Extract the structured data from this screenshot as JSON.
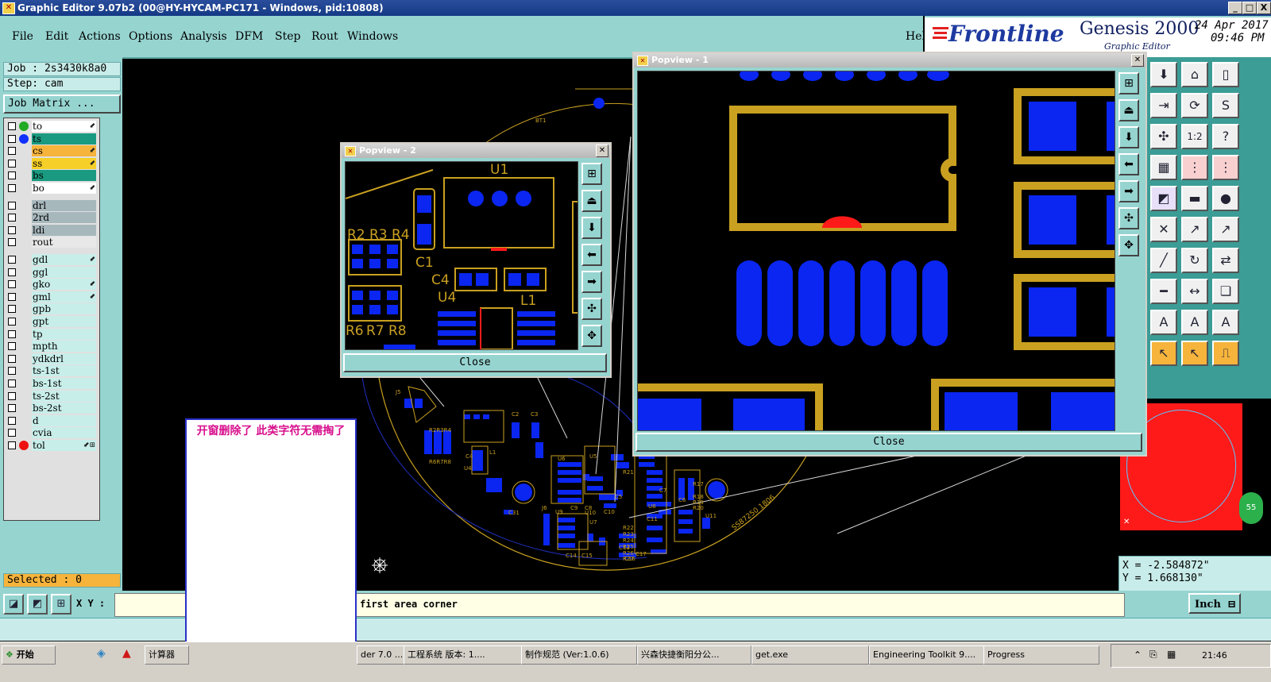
{
  "window": {
    "title": "Graphic Editor 9.07b2 (00@HY-HYCAM-PC171 - Windows, pid:10808)",
    "buttons": [
      "_",
      "□",
      "X"
    ]
  },
  "menu": {
    "items": [
      "File",
      "Edit",
      "Actions",
      "Options",
      "Analysis",
      "DFM",
      "Step",
      "Rout",
      "Windows"
    ],
    "help": "Help"
  },
  "brand": {
    "logo": "Frontline",
    "product": "Genesis 2000",
    "subtitle": "Graphic Editor",
    "date": "24 Apr 2017",
    "time": "09:46 PM"
  },
  "job": {
    "job_label": "Job : 2s3430k8a0",
    "step_label": "Step: cam",
    "matrix_button": "Job Matrix ..."
  },
  "layers": [
    {
      "name": "to",
      "dot": "#22aa22",
      "bg": "#ffffff",
      "mark": "⬋"
    },
    {
      "name": "ts",
      "dot": "#1030ff",
      "bg": "#1a9a80",
      "mark": ""
    },
    {
      "name": "cs",
      "dot": "",
      "bg": "#f6b43c",
      "mark": "⬋"
    },
    {
      "name": "ss",
      "dot": "",
      "bg": "#f6d028",
      "mark": "⬋"
    },
    {
      "name": "bs",
      "dot": "",
      "bg": "#1a9a80",
      "mark": ""
    },
    {
      "name": "bo",
      "dot": "",
      "bg": "#ffffff",
      "mark": "⬋"
    },
    {
      "name": "drl",
      "dot": "",
      "bg": "#a7b8bd",
      "mark": ""
    },
    {
      "name": "2rd",
      "dot": "",
      "bg": "#a7b8bd",
      "mark": ""
    },
    {
      "name": "ldi",
      "dot": "",
      "bg": "#a7b8bd",
      "mark": ""
    },
    {
      "name": "rout",
      "dot": "",
      "bg": "#e8e8e8",
      "mark": ""
    },
    {
      "name": "gdl",
      "dot": "",
      "bg": "#c8eeea",
      "mark": "⬋"
    },
    {
      "name": "ggl",
      "dot": "",
      "bg": "#c8eeea",
      "mark": ""
    },
    {
      "name": "gko",
      "dot": "",
      "bg": "#c8eeea",
      "mark": "⬋"
    },
    {
      "name": "gml",
      "dot": "",
      "bg": "#c8eeea",
      "mark": "⬋"
    },
    {
      "name": "gpb",
      "dot": "",
      "bg": "#c8eeea",
      "mark": ""
    },
    {
      "name": "gpt",
      "dot": "",
      "bg": "#c8eeea",
      "mark": ""
    },
    {
      "name": "tp",
      "dot": "",
      "bg": "#c8eeea",
      "mark": ""
    },
    {
      "name": "mpth",
      "dot": "",
      "bg": "#c8eeea",
      "mark": ""
    },
    {
      "name": "ydkdrl",
      "dot": "",
      "bg": "#c8eeea",
      "mark": ""
    },
    {
      "name": "ts-1st",
      "dot": "",
      "bg": "#c8eeea",
      "mark": ""
    },
    {
      "name": "bs-1st",
      "dot": "",
      "bg": "#c8eeea",
      "mark": ""
    },
    {
      "name": "ts-2st",
      "dot": "",
      "bg": "#c8eeea",
      "mark": ""
    },
    {
      "name": "bs-2st",
      "dot": "",
      "bg": "#c8eeea",
      "mark": ""
    },
    {
      "name": "d",
      "dot": "",
      "bg": "#c8eeea",
      "mark": ""
    },
    {
      "name": "cvia",
      "dot": "",
      "bg": "#c8eeea",
      "mark": ""
    },
    {
      "name": "tol",
      "dot": "#ee1111",
      "bg": "#c8eeea",
      "mark": "⬋⊞"
    }
  ],
  "selected": "Selected : 0",
  "popview2": {
    "title": "Popview - 2",
    "close": "Close",
    "labels": [
      "U1",
      "R2",
      "R3",
      "R4",
      "C1",
      "C4",
      "U4",
      "L1",
      "R6",
      "R7",
      "R8"
    ]
  },
  "popview1": {
    "title": "Popview - 1",
    "close": "Close"
  },
  "note": {
    "text": "开窗删除了   此类字符无需掏了"
  },
  "pcb_labels": [
    "BT1",
    "J5",
    "U6",
    "U5",
    "C9",
    "C8",
    "C5",
    "C10",
    "U7",
    "J6",
    "U9",
    "U10",
    "U8",
    "C6",
    "C7",
    "C11",
    "C13",
    "C14",
    "C15",
    "C16",
    "C17",
    "R17",
    "R18",
    "R19",
    "R20",
    "R21",
    "R22",
    "R23",
    "R24",
    "R25",
    "R26",
    "R27",
    "C31",
    "U11",
    "SS87250 1806",
    "R2R3R4",
    "R6R7R8",
    "C4",
    "U4",
    "L1",
    "C2",
    "C3"
  ],
  "coords": {
    "x": "X = -2.584872\"",
    "y": "Y =  1.668130\""
  },
  "command": {
    "xy_label": "X Y :",
    "prompt": "first area corner",
    "unit": "Inch"
  },
  "taskbar": {
    "start": "开始",
    "tasks": [
      "计算器",
      "der 7.0 ...",
      "工程系统  版本: 1....",
      "制作规范 (Ver:1.0.6)",
      "兴森快捷衡阳分公...",
      "get.exe",
      "Engineering Toolkit 9....",
      "Progress"
    ],
    "clock": "21:46"
  },
  "colors": {
    "teal": "#96d4d0",
    "pad_blue": "#0a26f0",
    "trace_gold": "#c9a020",
    "red": "#ff1a1a"
  }
}
